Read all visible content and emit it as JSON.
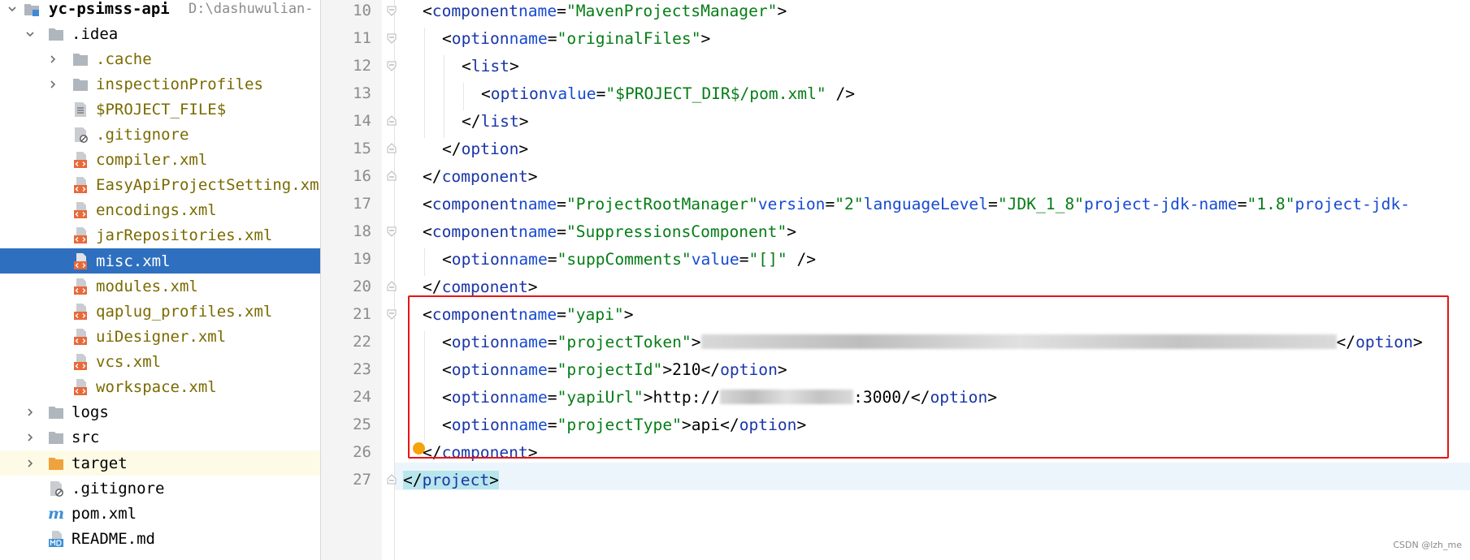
{
  "project_tree": {
    "root": {
      "name": "yc-psimss-api",
      "path": "D:\\dashuwulian-"
    },
    "items": [
      {
        "label": ".idea"
      },
      {
        "label": ".cache"
      },
      {
        "label": "inspectionProfiles"
      },
      {
        "label": "$PROJECT_FILE$"
      },
      {
        "label": ".gitignore"
      },
      {
        "label": "compiler.xml"
      },
      {
        "label": "EasyApiProjectSetting.xml"
      },
      {
        "label": "encodings.xml"
      },
      {
        "label": "jarRepositories.xml"
      },
      {
        "label": "misc.xml"
      },
      {
        "label": "modules.xml"
      },
      {
        "label": "qaplug_profiles.xml"
      },
      {
        "label": "uiDesigner.xml"
      },
      {
        "label": "vcs.xml"
      },
      {
        "label": "workspace.xml"
      },
      {
        "label": "logs"
      },
      {
        "label": "src"
      },
      {
        "label": "target"
      },
      {
        "label": ".gitignore"
      },
      {
        "label": "pom.xml"
      },
      {
        "label": "README.md"
      }
    ],
    "selected": "misc.xml",
    "colors": {
      "selected_bg": "#2f6fbf",
      "folder": "#b0b6bd",
      "target_folder": "#f0a23c",
      "xml_icon": "#e8693a"
    }
  },
  "editor": {
    "line_numbers": [
      "10",
      "11",
      "12",
      "13",
      "14",
      "15",
      "16",
      "17",
      "18",
      "19",
      "20",
      "21",
      "22",
      "23",
      "24",
      "25",
      "26",
      "27"
    ],
    "code": {
      "l10": {
        "o": "<",
        "tag": "component",
        "a1": "name",
        "v1": "\"MavenProjectsManager\"",
        "c": ">"
      },
      "l11": {
        "o": "<",
        "tag": "option",
        "a1": "name",
        "v1": "\"originalFiles\"",
        "c": ">"
      },
      "l12": {
        "o": "<",
        "tag": "list",
        "c": ">"
      },
      "l13": {
        "o": "<",
        "tag": "option",
        "a1": "value",
        "v1": "\"$PROJECT_DIR$/pom.xml\"",
        "c": " />"
      },
      "l14": {
        "o": "</",
        "tag": "list",
        "c": ">"
      },
      "l15": {
        "o": "</",
        "tag": "option",
        "c": ">"
      },
      "l16": {
        "o": "</",
        "tag": "component",
        "c": ">"
      },
      "l17": {
        "o": "<",
        "tag": "component",
        "a1": "name",
        "v1": "\"ProjectRootManager\"",
        "a2": "version",
        "v2": "\"2\"",
        "a3": "languageLevel",
        "v3": "\"JDK_1_8\"",
        "a4": "project-jdk-name",
        "v4": "\"1.8\"",
        "a5": "project-jdk-"
      },
      "l18": {
        "o": "<",
        "tag": "component",
        "a1": "name",
        "v1": "\"SuppressionsComponent\"",
        "c": ">"
      },
      "l19": {
        "o": "<",
        "tag": "option",
        "a1": "name",
        "v1": "\"suppComments\"",
        "a2": "value",
        "v2": "\"[]\"",
        "c": " />"
      },
      "l20": {
        "o": "</",
        "tag": "component",
        "c": ">"
      },
      "l21": {
        "o": "<",
        "tag": "component",
        "a1": "name",
        "v1": "\"yapi\"",
        "c": ">"
      },
      "l22": {
        "o": "<",
        "tag": "option",
        "a1": "name",
        "v1": "\"projectToken\"",
        "c": ">",
        "e": "</",
        "etag": "option",
        "ec": ">"
      },
      "l23": {
        "o": "<",
        "tag": "option",
        "a1": "name",
        "v1": "\"projectId\"",
        "c": ">",
        "text": "210",
        "e": "</",
        "etag": "option",
        "ec": ">"
      },
      "l24": {
        "o": "<",
        "tag": "option",
        "a1": "name",
        "v1": "\"yapiUrl\"",
        "c": ">",
        "text": "http://",
        "text2": ":3000/",
        "e": "</",
        "etag": "option",
        "ec": ">"
      },
      "l25": {
        "o": "<",
        "tag": "option",
        "a1": "name",
        "v1": "\"projectType\"",
        "c": ">",
        "text": "api",
        "e": "</",
        "etag": "option",
        "ec": ">"
      },
      "l26": {
        "o": "</",
        "tag": "component",
        "c": ">"
      },
      "l27": {
        "o": "</",
        "tag": "project",
        "c": ">"
      }
    },
    "colors": {
      "tag": "#1a36a8",
      "attr": "#174ad4",
      "string": "#067d17",
      "annotation_box": "#e81313",
      "current_line": "#edf5fc"
    }
  },
  "watermark": "CSDN @lzh_me"
}
